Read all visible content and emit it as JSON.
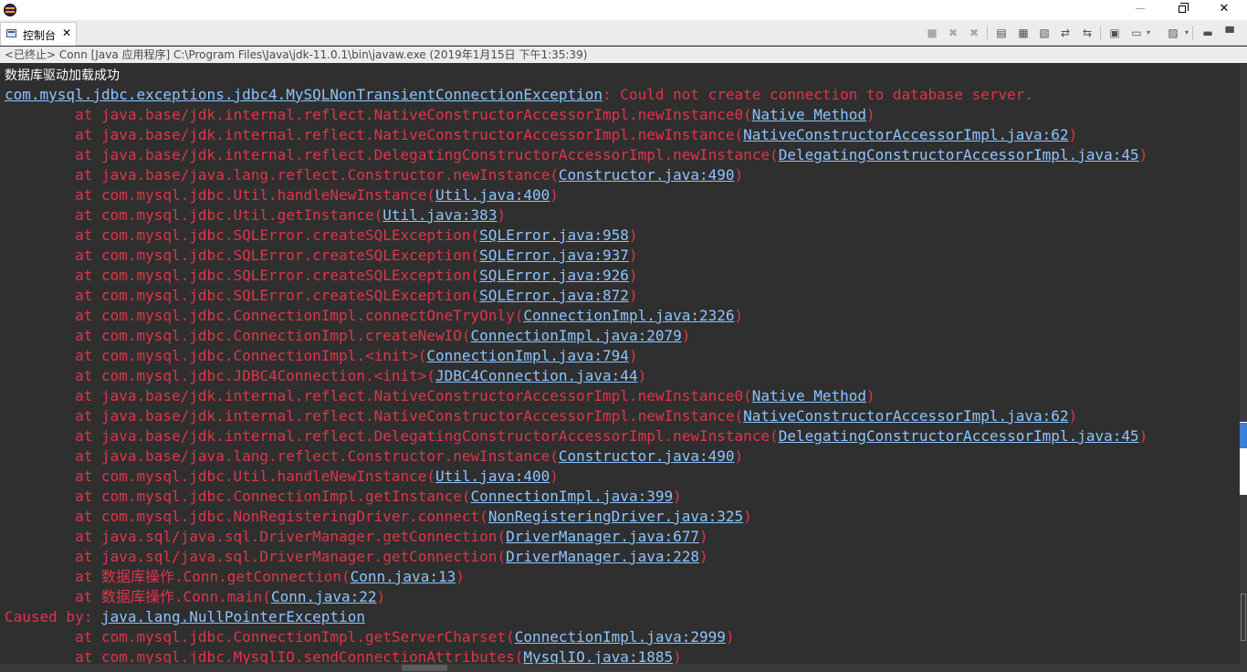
{
  "window": {
    "minimize_label": "—",
    "close_label": "✕"
  },
  "view_tab": {
    "label": "控制台",
    "close_label": "✕"
  },
  "toolbar": {
    "buttons": [
      {
        "icon": "terminate-icon",
        "glyph": "■",
        "enabled": false
      },
      {
        "icon": "remove-launch-icon",
        "glyph": "✖",
        "enabled": false
      },
      {
        "icon": "remove-all-terminated-icon",
        "glyph": "✖",
        "enabled": false
      },
      {
        "icon": "clear-console-icon",
        "glyph": "▤",
        "enabled": true
      },
      {
        "icon": "scroll-lock-icon",
        "glyph": "▦",
        "enabled": true
      },
      {
        "icon": "word-wrap-icon",
        "glyph": "▧",
        "enabled": true
      },
      {
        "icon": "show-on-stdout-icon",
        "glyph": "⇄",
        "enabled": true
      },
      {
        "icon": "show-on-stderr-icon",
        "glyph": "⇆",
        "enabled": true
      },
      {
        "icon": "pin-console-icon",
        "glyph": "▣",
        "enabled": true
      },
      {
        "icon": "display-console-icon",
        "glyph": "▭",
        "enabled": true
      },
      {
        "icon": "open-console-icon",
        "glyph": "▨",
        "enabled": true
      },
      {
        "icon": "view-minimize-icon",
        "glyph": "▬",
        "enabled": true
      },
      {
        "icon": "view-maximize-icon",
        "glyph": "▀",
        "enabled": true
      }
    ]
  },
  "status_line": "<已终止> Conn [Java 应用程序] C:\\Program Files\\Java\\jdk-11.0.1\\bin\\javaw.exe  (2019年1月15日 下午1:35:39)",
  "console": {
    "lines": [
      {
        "type": "plain",
        "text": "数据库驱动加载成功"
      },
      {
        "type": "exception",
        "link": "com.mysql.jdbc.exceptions.jdbc4.MySQLNonTransientConnectionException",
        "text": ": Could not create connection to database server."
      },
      {
        "type": "frame",
        "prefix": "        at java.base/jdk.internal.reflect.NativeConstructorAccessorImpl.newInstance0(",
        "link": "Native Method",
        "suffix": ")"
      },
      {
        "type": "frame",
        "prefix": "        at java.base/jdk.internal.reflect.NativeConstructorAccessorImpl.newInstance(",
        "link": "NativeConstructorAccessorImpl.java:62",
        "suffix": ")"
      },
      {
        "type": "frame",
        "prefix": "        at java.base/jdk.internal.reflect.DelegatingConstructorAccessorImpl.newInstance(",
        "link": "DelegatingConstructorAccessorImpl.java:45",
        "suffix": ")"
      },
      {
        "type": "frame",
        "prefix": "        at java.base/java.lang.reflect.Constructor.newInstance(",
        "link": "Constructor.java:490",
        "suffix": ")"
      },
      {
        "type": "frame",
        "prefix": "        at com.mysql.jdbc.Util.handleNewInstance(",
        "link": "Util.java:400",
        "suffix": ")"
      },
      {
        "type": "frame",
        "prefix": "        at com.mysql.jdbc.Util.getInstance(",
        "link": "Util.java:383",
        "suffix": ")"
      },
      {
        "type": "frame",
        "prefix": "        at com.mysql.jdbc.SQLError.createSQLException(",
        "link": "SQLError.java:958",
        "suffix": ")"
      },
      {
        "type": "frame",
        "prefix": "        at com.mysql.jdbc.SQLError.createSQLException(",
        "link": "SQLError.java:937",
        "suffix": ")"
      },
      {
        "type": "frame",
        "prefix": "        at com.mysql.jdbc.SQLError.createSQLException(",
        "link": "SQLError.java:926",
        "suffix": ")"
      },
      {
        "type": "frame",
        "prefix": "        at com.mysql.jdbc.SQLError.createSQLException(",
        "link": "SQLError.java:872",
        "suffix": ")"
      },
      {
        "type": "frame",
        "prefix": "        at com.mysql.jdbc.ConnectionImpl.connectOneTryOnly(",
        "link": "ConnectionImpl.java:2326",
        "suffix": ")"
      },
      {
        "type": "frame",
        "prefix": "        at com.mysql.jdbc.ConnectionImpl.createNewIO(",
        "link": "ConnectionImpl.java:2079",
        "suffix": ")"
      },
      {
        "type": "frame",
        "prefix": "        at com.mysql.jdbc.ConnectionImpl.<init>(",
        "link": "ConnectionImpl.java:794",
        "suffix": ")"
      },
      {
        "type": "frame",
        "prefix": "        at com.mysql.jdbc.JDBC4Connection.<init>(",
        "link": "JDBC4Connection.java:44",
        "suffix": ")"
      },
      {
        "type": "frame",
        "prefix": "        at java.base/jdk.internal.reflect.NativeConstructorAccessorImpl.newInstance0(",
        "link": "Native Method",
        "suffix": ")"
      },
      {
        "type": "frame",
        "prefix": "        at java.base/jdk.internal.reflect.NativeConstructorAccessorImpl.newInstance(",
        "link": "NativeConstructorAccessorImpl.java:62",
        "suffix": ")"
      },
      {
        "type": "frame",
        "prefix": "        at java.base/jdk.internal.reflect.DelegatingConstructorAccessorImpl.newInstance(",
        "link": "DelegatingConstructorAccessorImpl.java:45",
        "suffix": ")"
      },
      {
        "type": "frame",
        "prefix": "        at java.base/java.lang.reflect.Constructor.newInstance(",
        "link": "Constructor.java:490",
        "suffix": ")"
      },
      {
        "type": "frame",
        "prefix": "        at com.mysql.jdbc.Util.handleNewInstance(",
        "link": "Util.java:400",
        "suffix": ")"
      },
      {
        "type": "frame",
        "prefix": "        at com.mysql.jdbc.ConnectionImpl.getInstance(",
        "link": "ConnectionImpl.java:399",
        "suffix": ")"
      },
      {
        "type": "frame",
        "prefix": "        at com.mysql.jdbc.NonRegisteringDriver.connect(",
        "link": "NonRegisteringDriver.java:325",
        "suffix": ")"
      },
      {
        "type": "frame",
        "prefix": "        at java.sql/java.sql.DriverManager.getConnection(",
        "link": "DriverManager.java:677",
        "suffix": ")"
      },
      {
        "type": "frame",
        "prefix": "        at java.sql/java.sql.DriverManager.getConnection(",
        "link": "DriverManager.java:228",
        "suffix": ")"
      },
      {
        "type": "frame",
        "prefix": "        at 数据库操作.Conn.getConnection(",
        "link": "Conn.java:13",
        "suffix": ")"
      },
      {
        "type": "frame",
        "prefix": "        at 数据库操作.Conn.main(",
        "link": "Conn.java:22",
        "suffix": ")"
      },
      {
        "type": "frame",
        "prefix": "Caused by: ",
        "link": "java.lang.NullPointerException",
        "suffix": ""
      },
      {
        "type": "frame",
        "prefix": "        at com.mysql.jdbc.ConnectionImpl.getServerCharset(",
        "link": "ConnectionImpl.java:2999",
        "suffix": ")"
      },
      {
        "type": "frame",
        "prefix": "        at com.mysql.jdbc.MysqlIO.sendConnectionAttributes(",
        "link": "MysqlIO.java:1885",
        "suffix": ")"
      }
    ]
  },
  "colors": {
    "background": "#2f2f2f",
    "error_text": "#e0344a",
    "link_text": "#8ec5ff",
    "plain_text": "#ffffff"
  }
}
